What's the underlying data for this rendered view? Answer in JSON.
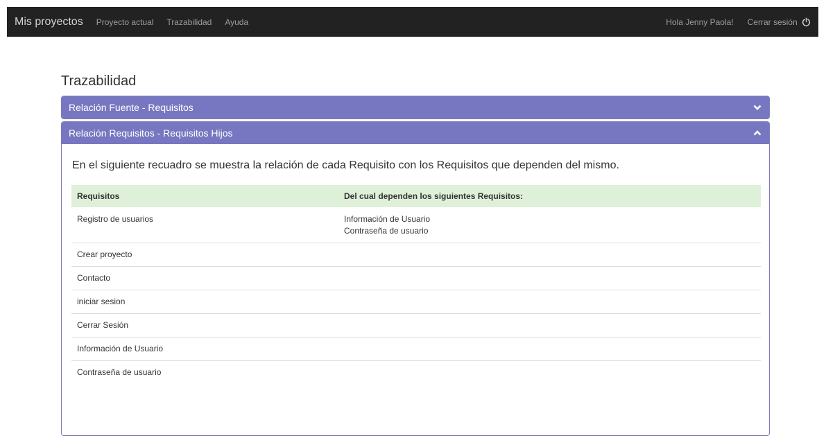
{
  "navbar": {
    "brand": "Mis proyectos",
    "links": [
      "Proyecto actual",
      "Trazabilidad",
      "Ayuda"
    ],
    "greeting": "Hola Jenny Paola!",
    "logout": "Cerrar sesión",
    "logout_icon": "power-icon"
  },
  "page": {
    "title": "Trazabilidad"
  },
  "panels": [
    {
      "title": "Relación Fuente - Requisitos",
      "state": "collapsed",
      "icon": "chevron-down-icon"
    },
    {
      "title": "Relación Requisitos - Requisitos Hijos",
      "state": "expanded",
      "icon": "chevron-up-icon"
    }
  ],
  "relation": {
    "intro": "En el siguiente recuadro se muestra la relación de cada Requisito con los Requisitos que dependen del mismo.",
    "headers": [
      "Requisitos",
      "Del cual dependen los siguientes Requisitos:"
    ],
    "rows": [
      {
        "requisito": "Registro de usuarios",
        "dependientes": [
          "Información de Usuario",
          "Contraseña de usuario"
        ]
      },
      {
        "requisito": "Crear proyecto",
        "dependientes": []
      },
      {
        "requisito": "Contacto",
        "dependientes": []
      },
      {
        "requisito": "iniciar sesion",
        "dependientes": []
      },
      {
        "requisito": "Cerrar Sesión",
        "dependientes": []
      },
      {
        "requisito": "Información de Usuario",
        "dependientes": []
      },
      {
        "requisito": "Contraseña de usuario",
        "dependientes": []
      }
    ]
  },
  "colors": {
    "navbar_bg": "#222222",
    "panel_heading": "#7777c1",
    "table_header": "#dff0d8"
  }
}
